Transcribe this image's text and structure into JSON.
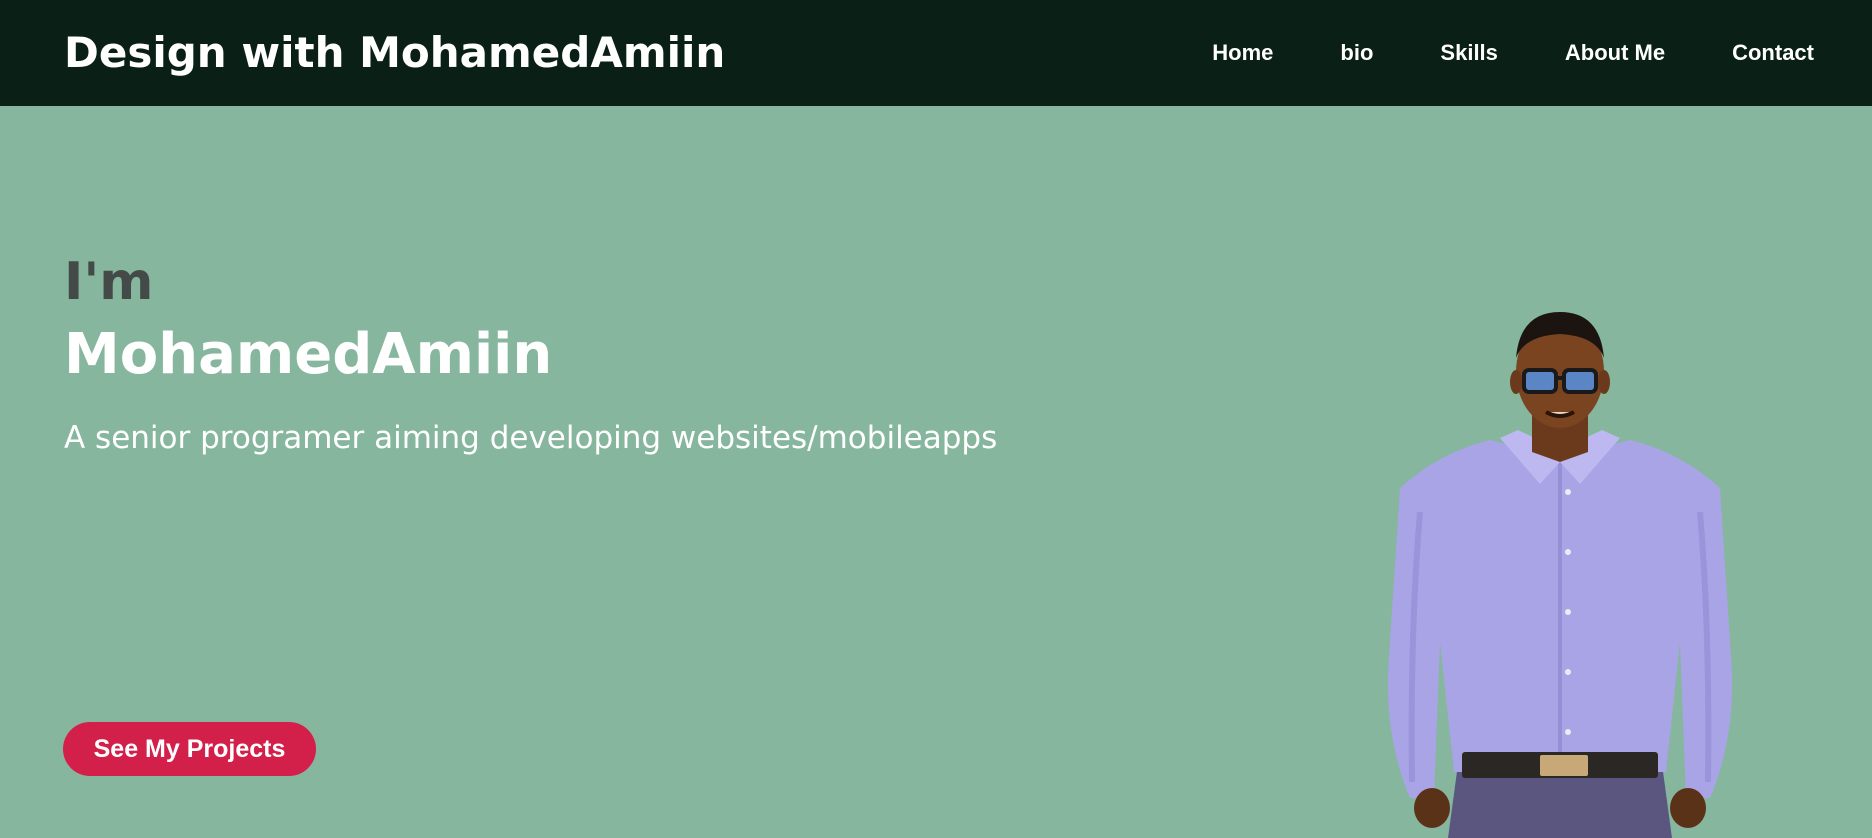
{
  "header": {
    "brand": "Design with MohamedAmiin",
    "nav": [
      {
        "label": "Home"
      },
      {
        "label": "bio"
      },
      {
        "label": "Skills"
      },
      {
        "label": "About Me"
      },
      {
        "label": "Contact"
      }
    ]
  },
  "hero": {
    "intro": "I'm",
    "name": "MohamedAmiin",
    "tagline": "A senior programer aiming developing websites/mobileapps",
    "cta_label": "See My Projects"
  },
  "colors": {
    "header_bg": "#0a1f15",
    "hero_bg": "#86b69e",
    "cta_bg": "#d3204a",
    "intro_text": "#444a47"
  }
}
